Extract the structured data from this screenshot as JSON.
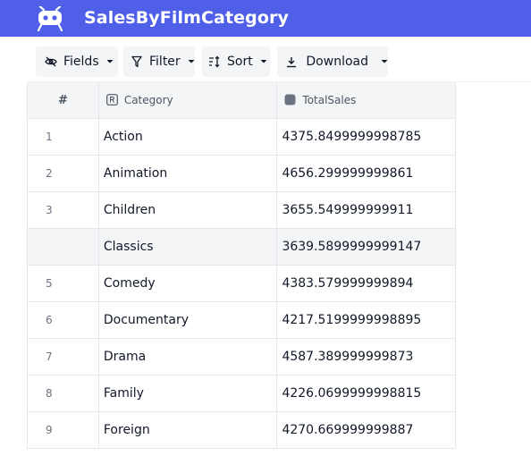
{
  "header": {
    "title": "SalesByFilmCategory",
    "logo_icon": "nocodb-logo-icon",
    "bg_color": "#4f5fe8"
  },
  "toolbar": {
    "fields_label": "Fields",
    "filter_label": "Filter",
    "sort_label": "Sort",
    "download_label": "Download"
  },
  "table": {
    "columns": {
      "row_number": "#",
      "category": "Category",
      "total_sales": "TotalSales"
    },
    "rows": [
      {
        "num": "1",
        "category": "Action",
        "total_sales": "4375.8499999998785"
      },
      {
        "num": "2",
        "category": "Animation",
        "total_sales": "4656.299999999861"
      },
      {
        "num": "3",
        "category": "Children",
        "total_sales": "3655.549999999911"
      },
      {
        "num": "",
        "category": "Classics",
        "total_sales": "3639.5899999999147"
      },
      {
        "num": "5",
        "category": "Comedy",
        "total_sales": "4383.579999999894"
      },
      {
        "num": "6",
        "category": "Documentary",
        "total_sales": "4217.5199999998895"
      },
      {
        "num": "7",
        "category": "Drama",
        "total_sales": "4587.389999999873"
      },
      {
        "num": "8",
        "category": "Family",
        "total_sales": "4226.0699999998815"
      },
      {
        "num": "9",
        "category": "Foreign",
        "total_sales": "4270.669999999887"
      }
    ]
  }
}
